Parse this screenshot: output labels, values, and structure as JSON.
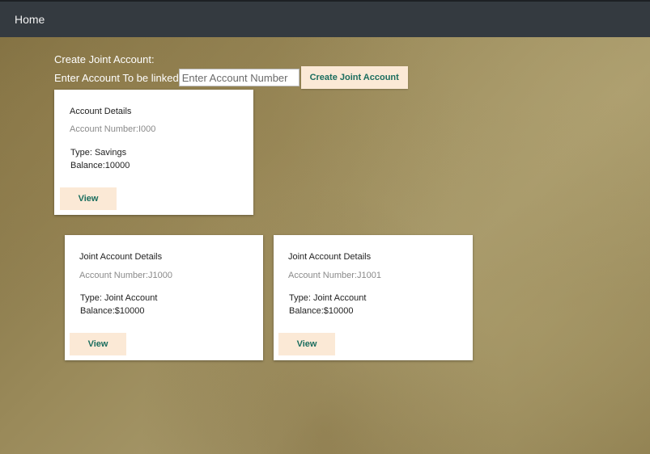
{
  "nav": {
    "home_label": "Home"
  },
  "create": {
    "heading": "Create Joint Account:",
    "link_label": "Enter Account To be linked",
    "input_placeholder": "Enter Account Number",
    "button_label": "Create Joint Account"
  },
  "account": {
    "title": "Account Details",
    "number": "Account Number:I000",
    "type": "Type: Savings",
    "balance": "Balance:10000",
    "view_label": "View"
  },
  "joint_accounts": [
    {
      "title": "Joint Account Details",
      "number": "Account Number:J1000",
      "type": "Type: Joint Account",
      "balance": "Balance:$10000",
      "view_label": "View"
    },
    {
      "title": "Joint Account Details",
      "number": "Account Number:J1001",
      "type": "Type: Joint Account",
      "balance": "Balance:$10000",
      "view_label": "View"
    }
  ],
  "colors": {
    "navbar": "#343a40",
    "button_bg": "#fbe9d6",
    "button_text": "#1a6d5e"
  }
}
